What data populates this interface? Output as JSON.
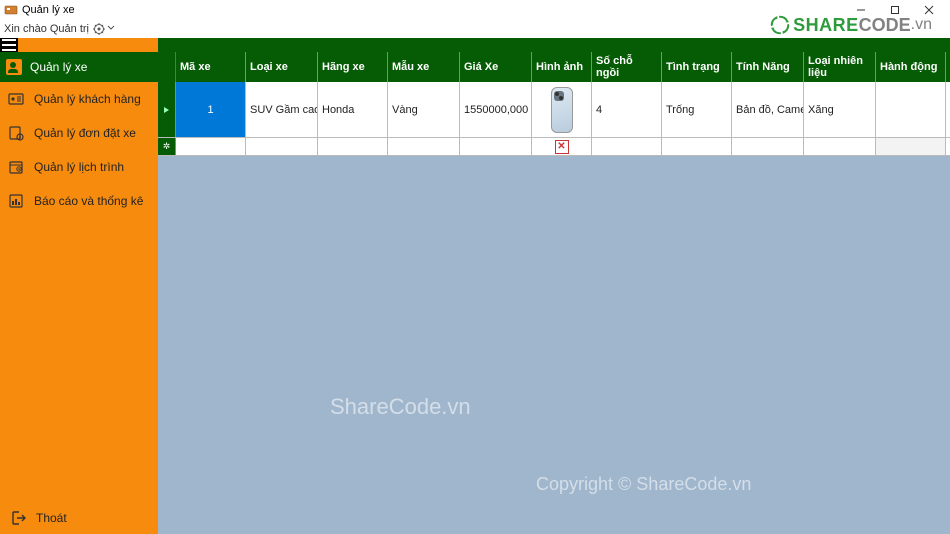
{
  "window": {
    "title": "Quản lý xe",
    "greeting": "Xin chào Quản trị"
  },
  "logo": {
    "green": "SHARE",
    "gray": "CODE",
    "suffix": ".vn"
  },
  "sidebar": {
    "header": "Quản lý xe",
    "items": [
      {
        "label": "Quản lý khách hàng"
      },
      {
        "label": "Quản lý đơn đặt xe"
      },
      {
        "label": "Quản lý lịch trình"
      },
      {
        "label": "Báo cáo và thống kê"
      }
    ],
    "exit": "Thoát"
  },
  "table": {
    "headers": {
      "ma": "Mã xe",
      "loai": "Loại xe",
      "hang": "Hãng xe",
      "mau": "Mẫu xe",
      "gia": "Giá Xe",
      "hinh": "Hình ảnh",
      "cho": "Số chỗ ngồi",
      "tinh": "Tình trạng",
      "nang": "Tính Năng",
      "nhien": "Loại nhiên liệu",
      "hanh": "Hành động"
    },
    "row": {
      "ma": "1",
      "loai": "SUV Gầm cao",
      "hang": "Honda",
      "mau": "Vàng",
      "gia": "1550000,000",
      "cho": "4",
      "tinh": "Trống",
      "nang": "Bản đồ, Came...",
      "nhien": "Xăng"
    }
  },
  "watermarks": {
    "w1": "ShareCode.vn",
    "w2": "Copyright © ShareCode.vn"
  }
}
